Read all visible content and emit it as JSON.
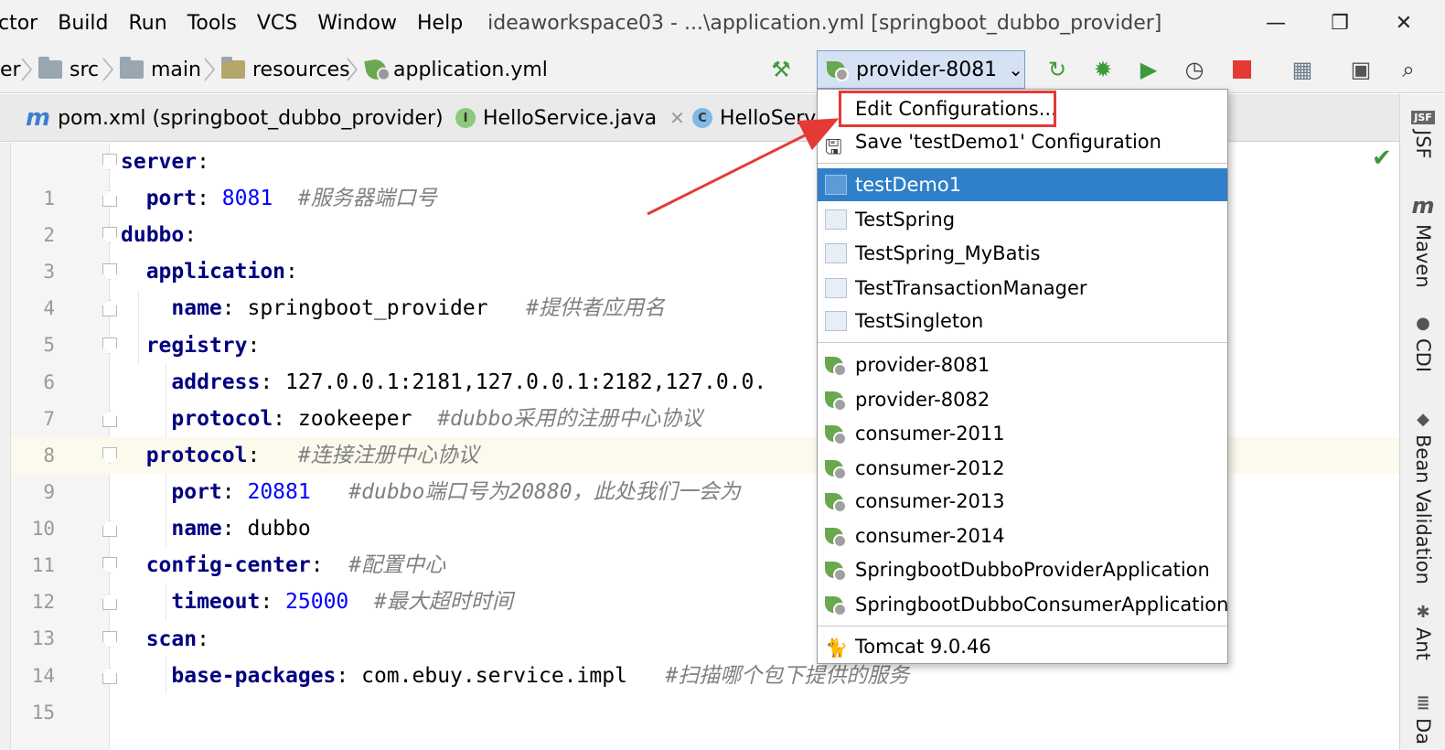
{
  "menu": {
    "items": [
      "ctor",
      "Build",
      "Run",
      "Tools",
      "VCS",
      "Window",
      "Help"
    ],
    "title": "ideaworkspace03 - ...\\application.yml [springboot_dubbo_provider]",
    "minimize": "—",
    "restore": "❐",
    "close": "✕"
  },
  "breadcrumb": {
    "first": "er",
    "src": "src",
    "main": "main",
    "resources": "resources",
    "file": "application.yml"
  },
  "toolbar": {
    "run_config": "provider-8081",
    "dropdown": "⌄",
    "icons": [
      "build-hammer-icon",
      "rerun-icon",
      "debug-icon",
      "coverage-icon",
      "profiler-icon",
      "stop-icon",
      "project-structure-icon",
      "terminal-icon",
      "search-icon"
    ],
    "colors": {
      "accent": "#2f80c8",
      "stop": "#e53935",
      "run": "#3c9a3c"
    }
  },
  "tabs": [
    {
      "label": "pom.xml (springboot_dubbo_provider)",
      "icon": "maven-icon",
      "close": "✕"
    },
    {
      "label": "HelloService.java",
      "icon": "I",
      "close": "✕"
    },
    {
      "label": "HelloServic",
      "icon": "C"
    }
  ],
  "editor": {
    "lines": [
      {
        "no": "1",
        "key": "server",
        "colon": ":",
        "value": "",
        "comment": ""
      },
      {
        "no": "2",
        "key": "port",
        "colon": ": ",
        "value": "8081",
        "comment": "#服务器端口号"
      },
      {
        "no": "3",
        "key": "dubbo",
        "colon": ":",
        "value": "",
        "comment": ""
      },
      {
        "no": "4",
        "key": "application",
        "colon": ":",
        "value": "",
        "comment": ""
      },
      {
        "no": "5",
        "key": "name",
        "colon": ": ",
        "value": "springboot_provider",
        "comment": "#提供者应用名"
      },
      {
        "no": "6",
        "key": "registry",
        "colon": ":",
        "value": "",
        "comment": ""
      },
      {
        "no": "7",
        "key": "address",
        "colon": ": ",
        "value": "127.0.0.1:2181,127.0.0.1:2182,127.0.0.",
        "comment": ""
      },
      {
        "no": "8",
        "key": "protocol",
        "colon": ": ",
        "value": "zookeeper",
        "comment": "#dubbo采用的注册中心协议"
      },
      {
        "no": "9",
        "key": "protocol",
        "colon": ": ",
        "value": "",
        "comment": "#连接注册中心协议"
      },
      {
        "no": "10",
        "key": "port",
        "colon": ": ",
        "value": "20881",
        "comment": "#dubbo端口号为20880，此处我们一会为"
      },
      {
        "no": "11",
        "key": "name",
        "colon": ": ",
        "value": "dubbo",
        "comment": ""
      },
      {
        "no": "12",
        "key": "config-center",
        "colon": ": ",
        "value": "",
        "comment": "#配置中心"
      },
      {
        "no": "13",
        "key": "timeout",
        "colon": ": ",
        "value": "25000",
        "comment": "#最大超时时间"
      },
      {
        "no": "14",
        "key": "scan",
        "colon": ":",
        "value": "",
        "comment": ""
      },
      {
        "no": "15",
        "key": "base-packages",
        "colon": ": ",
        "value": "com.ebuy.service.impl",
        "comment": "#扫描哪个包下提供的服务"
      }
    ]
  },
  "popup": {
    "edit": "Edit Configurations...",
    "save": "Save 'testDemo1' Configuration",
    "group1": [
      "testDemo1",
      "TestSpring",
      "TestSpring_MyBatis",
      "TestTransactionManager",
      "TestSingleton"
    ],
    "selected": "testDemo1",
    "group2": [
      "provider-8081",
      "provider-8082",
      "consumer-2011",
      "consumer-2012",
      "consumer-2013",
      "consumer-2014",
      "SpringbootDubboProviderApplication",
      "SpringbootDubboConsumerApplication"
    ],
    "tomcat": "Tomcat 9.0.46"
  },
  "right_tools": [
    {
      "icon": "JSF",
      "label": "JSF"
    },
    {
      "icon": "m",
      "label": "Maven"
    },
    {
      "icon": "●",
      "label": "CDI"
    },
    {
      "icon": "◆",
      "label": "Bean Validation"
    },
    {
      "icon": "✱",
      "label": "Ant"
    },
    {
      "icon": "≣",
      "label": "Da"
    }
  ]
}
